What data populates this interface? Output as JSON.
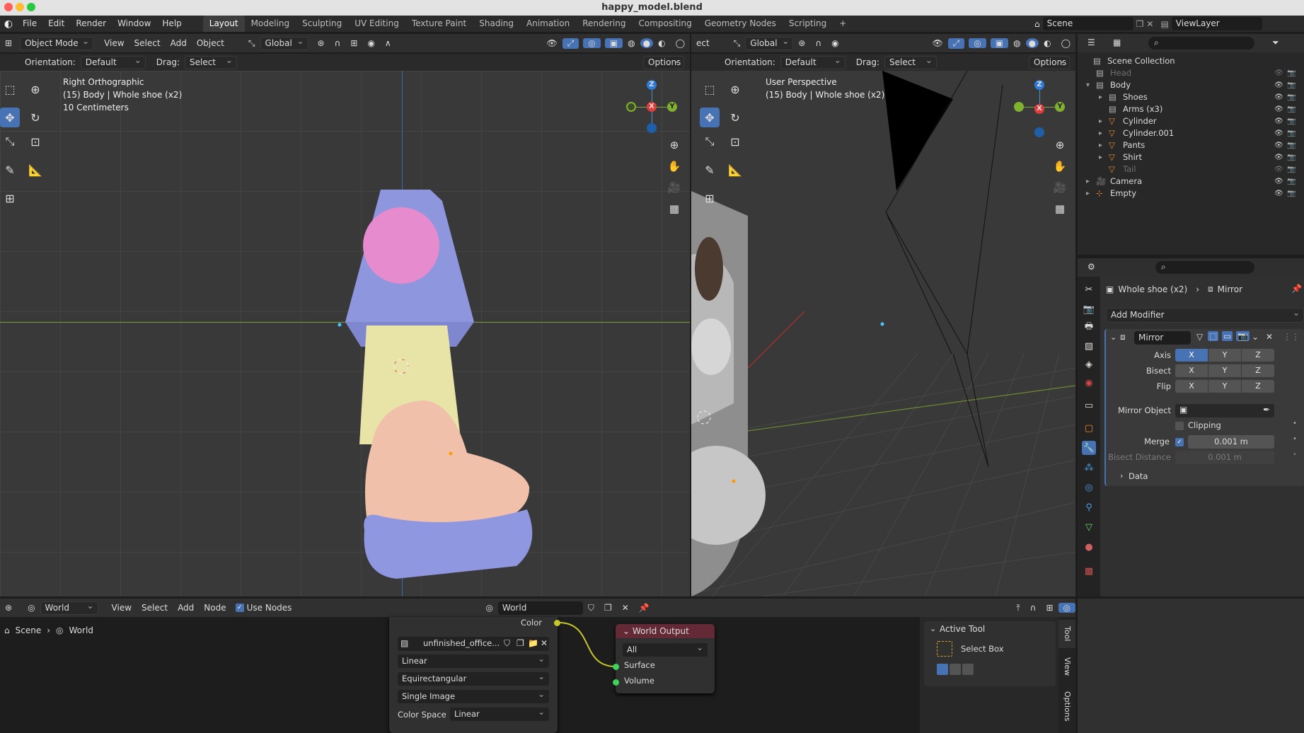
{
  "window": {
    "title": "happy_model.blend"
  },
  "menu": [
    "File",
    "Edit",
    "Render",
    "Window",
    "Help"
  ],
  "workspaces": [
    "Layout",
    "Modeling",
    "Sculpting",
    "UV Editing",
    "Texture Paint",
    "Shading",
    "Animation",
    "Rendering",
    "Compositing",
    "Geometry Nodes",
    "Scripting",
    "+"
  ],
  "scene": {
    "name": "Scene",
    "view_layer": "ViewLayer"
  },
  "viewport_left": {
    "mode": "Object Mode",
    "menus": [
      "View",
      "Select",
      "Add",
      "Object"
    ],
    "transform": "Global",
    "orientation_label": "Orientation:",
    "orientation": "Default",
    "drag_label": "Drag:",
    "drag": "Select Box",
    "options": "Options",
    "overlay": [
      "Right Orthographic",
      "(15) Body | Whole shoe (x2)",
      "10 Centimeters"
    ]
  },
  "viewport_right": {
    "cut_label": "ect",
    "transform": "Global",
    "orientation_label": "Orientation:",
    "orientation": "Default",
    "drag_label": "Drag:",
    "drag": "Select Box",
    "options": "Options",
    "overlay": [
      "User Perspective",
      "(15) Body | Whole shoe (x2)"
    ]
  },
  "gizmo": {
    "x": "X",
    "y": "Y",
    "z": "Z"
  },
  "outliner": {
    "root": "Scene Collection",
    "items": [
      {
        "name": "Head",
        "indent": 1,
        "dim": true
      },
      {
        "name": "Body",
        "indent": 1,
        "dim": false
      },
      {
        "name": "Shoes",
        "indent": 2,
        "dim": false
      },
      {
        "name": "Arms (x3)",
        "indent": 2,
        "dim": false
      },
      {
        "name": "Cylinder",
        "indent": 2,
        "dim": false
      },
      {
        "name": "Cylinder.001",
        "indent": 2,
        "dim": false
      },
      {
        "name": "Pants",
        "indent": 2,
        "dim": false
      },
      {
        "name": "Shirt",
        "indent": 2,
        "dim": false
      },
      {
        "name": "Tail",
        "indent": 2,
        "dim": true
      },
      {
        "name": "Camera",
        "indent": 1,
        "dim": false
      },
      {
        "name": "Empty",
        "indent": 1,
        "dim": false
      }
    ]
  },
  "properties": {
    "breadcrumb_object": "Whole shoe (x2)",
    "breadcrumb_modifier": "Mirror",
    "add_modifier": "Add Modifier",
    "modifier_name": "Mirror",
    "axis_label": "Axis",
    "bisect_label": "Bisect",
    "flip_label": "Flip",
    "axes": [
      "X",
      "Y",
      "Z"
    ],
    "mirror_object_label": "Mirror Object",
    "clipping_label": "Clipping",
    "merge_label": "Merge",
    "merge_value": "0.001 m",
    "bisect_distance_label": "Bisect Distance",
    "bisect_distance_value": "0.001 m",
    "data_label": "Data"
  },
  "node_editor": {
    "world_type": "World",
    "menus": [
      "View",
      "Select",
      "Add",
      "Node"
    ],
    "use_nodes": "Use Nodes",
    "datablock": "World",
    "breadcrumb": [
      "Scene",
      "World"
    ],
    "image_node": {
      "color_socket": "Color",
      "image_name": "unfinished_office...",
      "interpolation": "Linear",
      "projection": "Equirectangular",
      "source": "Single Image",
      "color_space_label": "Color Space",
      "color_space": "Linear"
    },
    "output_node": {
      "title": "World Output",
      "target": "All",
      "surface": "Surface",
      "volume": "Volume"
    },
    "side_panel": {
      "section": "Active Tool",
      "tool": "Select Box",
      "tabs": [
        "Tool",
        "View",
        "Options"
      ]
    }
  }
}
